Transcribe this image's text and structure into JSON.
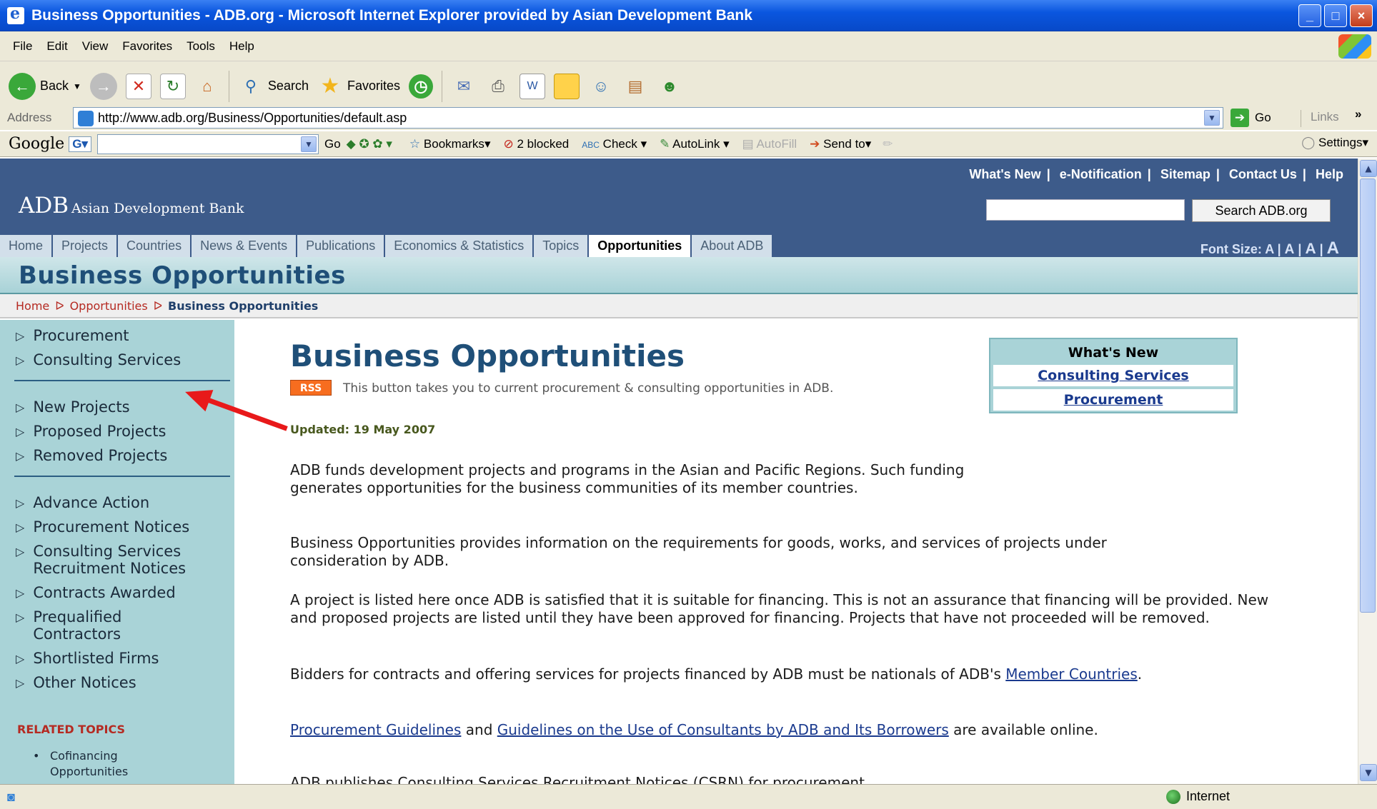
{
  "window": {
    "title": "Business Opportunities - ADB.org - Microsoft Internet Explorer provided by Asian Development Bank",
    "controls": [
      "_",
      "□",
      "×"
    ]
  },
  "menu": [
    "File",
    "Edit",
    "View",
    "Favorites",
    "Tools",
    "Help"
  ],
  "toolbar": {
    "back_label": "Back",
    "search_label": "Search",
    "favorites_label": "Favorites"
  },
  "address": {
    "label": "Address",
    "url": "http://www.adb.org/Business/Opportunities/default.asp",
    "go_label": "Go",
    "links_label": "Links",
    "links_more": "»"
  },
  "google": {
    "logo": "Google",
    "go_label": "Go",
    "bookmarks": "Bookmarks",
    "blocked": "2 blocked",
    "check": "Check",
    "autolink": "AutoLink",
    "autofill": "AutoFill",
    "sendto": "Send to",
    "settings": "Settings"
  },
  "site": {
    "brand_abbr": "ADB",
    "brand_name": "Asian Development Bank",
    "toplinks": [
      "What's New",
      "e-Notification",
      "Sitemap",
      "Contact Us",
      "Help"
    ],
    "search_button": "Search ADB.org",
    "nav": [
      "Home",
      "Projects",
      "Countries",
      "News & Events",
      "Publications",
      "Economics & Statistics",
      "Topics",
      "Opportunities",
      "About ADB"
    ],
    "font_size_label": "Font Size:",
    "font_sizes": [
      "A",
      "A",
      "A",
      "A"
    ],
    "banner_title": "Business Opportunities",
    "breadcrumb": [
      "Home",
      "Opportunities",
      "Business Opportunities"
    ]
  },
  "leftnav": {
    "group1": [
      "Procurement",
      "Consulting Services"
    ],
    "group2": [
      "New Projects",
      "Proposed Projects",
      "Removed Projects"
    ],
    "group3": [
      "Advance Action",
      "Procurement Notices",
      "Consulting Services Recruitment Notices",
      "Contracts Awarded",
      "Prequalified Contractors",
      "Shortlisted Firms",
      "Other Notices"
    ],
    "related_heading": "RELATED TOPICS",
    "related_items": [
      "Cofinancing Opportunities"
    ]
  },
  "main": {
    "title": "Business Opportunities",
    "rss_badge": "RSS",
    "rss_text": "This button takes you to current procurement & consulting opportunities in ADB.",
    "updated": "Updated: 19 May 2007",
    "p1": "ADB funds development projects and programs in the Asian and Pacific Regions. Such funding generates opportunities for the business communities of its member countries.",
    "p2": "Business Opportunities provides information on the requirements for goods, works, and services of projects under consideration by ADB.",
    "p3": "A project is listed here once ADB is satisfied that it is suitable for financing. This is not an assurance that financing will be provided. New and proposed projects are listed until they have been approved for financing. Projects that have not proceeded will be removed.",
    "p4_text": "Bidders for contracts and offering services for projects financed by ADB must be nationals of ADB's",
    "p4_link": "Member Countries",
    "p4_end": ".",
    "p5_link1": "Procurement Guidelines",
    "p5_mid": " and ",
    "p5_link2": "Guidelines on the Use of Consultants by ADB and Its Borrowers",
    "p5_end": " are available online.",
    "p6_partial": "ADB publishes Consulting Services Recruitment Notices (CSRN) for procurement..."
  },
  "whatsnew": {
    "heading": "What's New",
    "links": [
      "Consulting Services",
      "Procurement"
    ]
  },
  "status": {
    "zone": "Internet"
  }
}
